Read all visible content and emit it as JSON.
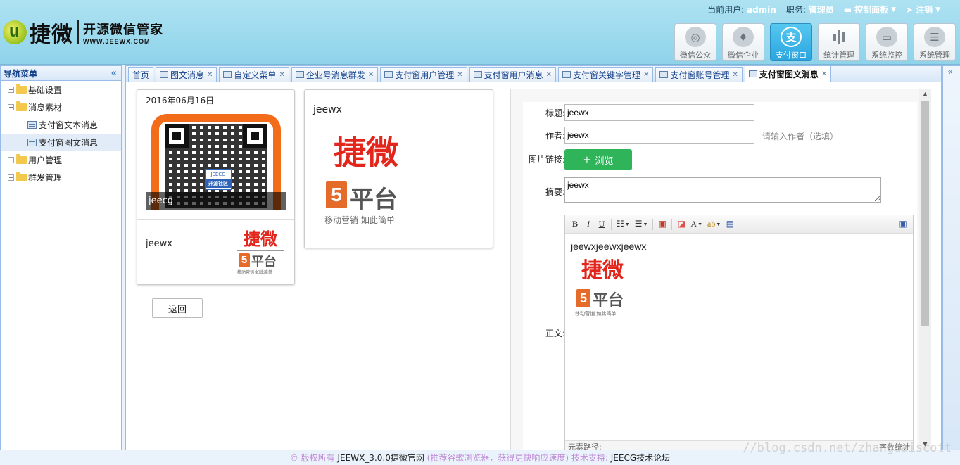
{
  "header": {
    "logo_brand": "捷微",
    "logo_sub_cn": "开源微信管家",
    "logo_sub_en": "WWW.JEEWX.COM",
    "current_user_label": "当前用户:",
    "current_user": "admin",
    "role_label": "职务:",
    "role": "管理员",
    "control_panel": "控制面板",
    "logout": "注销",
    "modules": [
      {
        "label": "微信公众",
        "icon": "wechat-icon",
        "glyph": "◎"
      },
      {
        "label": "微信企业",
        "icon": "tie-icon",
        "glyph": "♦"
      },
      {
        "label": "支付窗口",
        "icon": "alipay-icon",
        "glyph": "支"
      },
      {
        "label": "统计管理",
        "icon": "bar-chart-icon",
        "glyph": ""
      },
      {
        "label": "系统监控",
        "icon": "monitor-icon",
        "glyph": "▭"
      },
      {
        "label": "系统管理",
        "icon": "settings-panel-icon",
        "glyph": "☰"
      }
    ],
    "active_module": "支付窗口"
  },
  "nav": {
    "title": "导航菜单",
    "items": [
      {
        "label": "基础设置",
        "toggle": "+"
      },
      {
        "label": "消息素材",
        "toggle": "−"
      },
      {
        "label": "支付窗文本消息"
      },
      {
        "label": "支付窗图文消息"
      },
      {
        "label": "用户管理",
        "toggle": "+"
      },
      {
        "label": "群发管理",
        "toggle": "+"
      }
    ]
  },
  "tabs": [
    {
      "label": "首页"
    },
    {
      "label": "图文消息"
    },
    {
      "label": "自定义菜单"
    },
    {
      "label": "企业号消息群发"
    },
    {
      "label": "支付窗用户管理"
    },
    {
      "label": "支付窗用户消息"
    },
    {
      "label": "支付窗关键字管理"
    },
    {
      "label": "支付窗账号管理"
    },
    {
      "label": "支付窗图文消息"
    }
  ],
  "preview": {
    "date": "2016年06月16日",
    "cover_caption": "jeecg",
    "qr_badge_top": "JEECG",
    "qr_badge_bottom": "开源社区",
    "sub_title": "jeewx",
    "back_label": "返回",
    "single_title": "jeewx"
  },
  "logo_art": {
    "word": "捷微",
    "h5": "5",
    "platform": "平台",
    "tagline": "移动营销 如此简单"
  },
  "form": {
    "title_label": "标题:",
    "title_value": "jeewx",
    "author_label": "作者:",
    "author_value": "jeewx",
    "author_hint": "请输入作者（选填）",
    "image_label": "图片链接:",
    "browse_label": "浏览",
    "browse_icon": "+",
    "summary_label": "摘要:",
    "summary_value": "jeewx",
    "body_label": "正文:",
    "body_text": "jeewxjeewxjeewx",
    "status_left": "元素路径:",
    "status_right": "字数统计"
  },
  "footer": {
    "copyright_prefix": "© 版权所有",
    "site": "JEEWX_3.0.0捷微官网",
    "recommend": "(推荐谷歌浏览器，获得更快响应速度)",
    "support_label": "技术支持:",
    "support": "JEECG技术论坛"
  },
  "watermark": "//blog.csdn.net/zhangdaiscott"
}
